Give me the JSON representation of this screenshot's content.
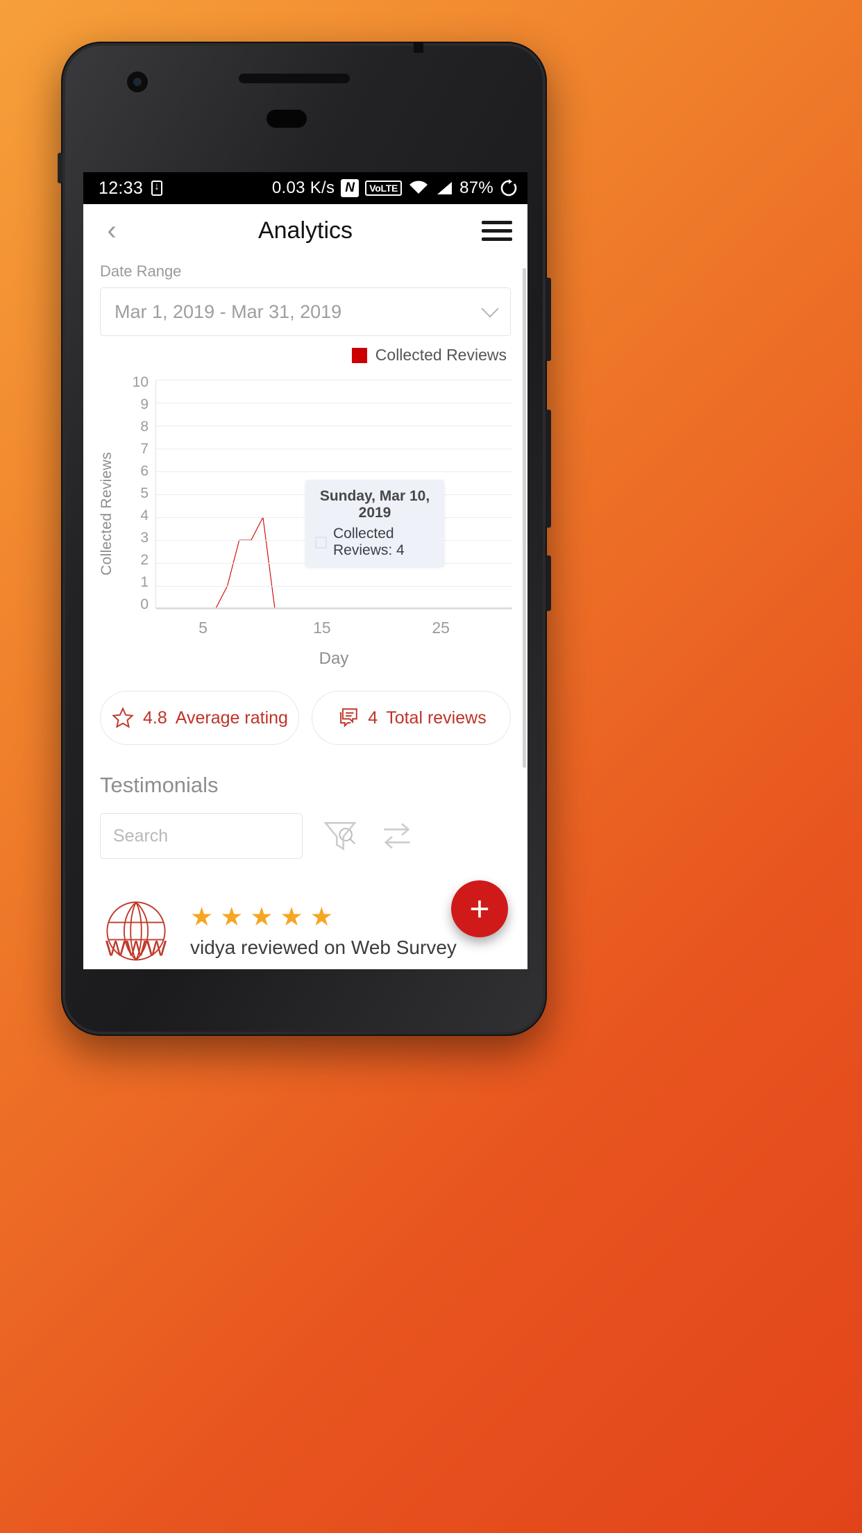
{
  "status_bar": {
    "time": "12:33",
    "download_icon": "download-icon",
    "network_speed": "0.03 K/s",
    "nfc_icon": "nfc-icon",
    "volte_label": "VoLTE",
    "wifi_icon": "wifi-icon",
    "signal_icon": "signal-icon",
    "battery": "87%",
    "rotation_icon": "rotation-lock-icon"
  },
  "app_bar": {
    "back_icon": "chevron-left-icon",
    "title": "Analytics",
    "menu_icon": "hamburger-menu-icon"
  },
  "date_range": {
    "label": "Date Range",
    "value": "Mar 1, 2019 - Mar 31, 2019",
    "chevron_icon": "chevron-down-icon"
  },
  "chart_legend": {
    "label": "Collected Reviews",
    "color": "#cc0000"
  },
  "tooltip": {
    "title": "Sunday, Mar 10, 2019",
    "value": "Collected Reviews: 4"
  },
  "stats": [
    {
      "icon": "star-outline-icon",
      "value": "4.8",
      "text": "Average rating"
    },
    {
      "icon": "reviews-bubble-icon",
      "value": "4",
      "text": "Total reviews"
    }
  ],
  "testimonials": {
    "heading": "Testimonials",
    "search_placeholder": "Search",
    "search_value": "",
    "search_icon": "search-icon",
    "filter_icon": "funnel-filter-icon",
    "sort_icon": "sort-swap-icon"
  },
  "review": {
    "avatar_icon": "www-globe-icon",
    "stars": 5,
    "star_glyph": "★",
    "text": "vidya reviewed on Web Survey"
  },
  "fab": {
    "icon": "plus-icon",
    "label": "+",
    "color": "#d01a1a"
  },
  "chart_data": {
    "type": "line",
    "title": "",
    "xlabel": "Day",
    "ylabel": "Collected Reviews",
    "ylim": [
      0,
      10
    ],
    "xlim": [
      1,
      31
    ],
    "grid": true,
    "legend_position": "top-right",
    "y_ticks": [
      "10",
      "9",
      "8",
      "7",
      "6",
      "5",
      "4",
      "3",
      "2",
      "1",
      "0"
    ],
    "x_ticks": [
      "5",
      "15",
      "25"
    ],
    "series": [
      {
        "name": "Collected Reviews",
        "color": "#cc0000",
        "x": [
          1,
          2,
          3,
          4,
          5,
          6,
          7,
          8,
          9,
          10,
          11,
          12,
          13,
          14,
          15,
          16,
          17,
          18,
          19,
          20,
          21,
          22,
          23,
          24,
          25,
          26,
          27,
          28,
          29,
          30,
          31
        ],
        "values": [
          0,
          0,
          0,
          0,
          0,
          0,
          1,
          3,
          3,
          4,
          0,
          0,
          0,
          0,
          0,
          0,
          0,
          0,
          0,
          0,
          0,
          0,
          0,
          0,
          0,
          0,
          0,
          0,
          0,
          0,
          0
        ]
      }
    ],
    "highlight_point": {
      "x": 10,
      "y": 4,
      "label": "Sunday, Mar 10, 2019"
    }
  }
}
